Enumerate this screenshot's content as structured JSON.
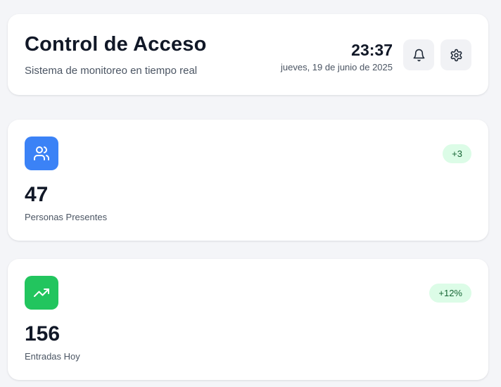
{
  "header": {
    "title": "Control de Acceso",
    "subtitle": "Sistema de monitoreo en tiempo real",
    "time": "23:37",
    "date": "jueves, 19 de junio de 2025",
    "actions": [
      {
        "icon": "bell-icon"
      },
      {
        "icon": "gear-icon"
      }
    ]
  },
  "stats": [
    {
      "icon": "users-icon",
      "icon_color": "#3b82f6",
      "value": "47",
      "label": "Personas Presentes",
      "badge": "+3"
    },
    {
      "icon": "trending-up-icon",
      "icon_color": "#22c55e",
      "value": "156",
      "label": "Entradas Hoy",
      "badge": "+12%"
    }
  ],
  "colors": {
    "background": "#f4f5f8",
    "badge_bg": "#dcfce7",
    "badge_text": "#166534"
  }
}
